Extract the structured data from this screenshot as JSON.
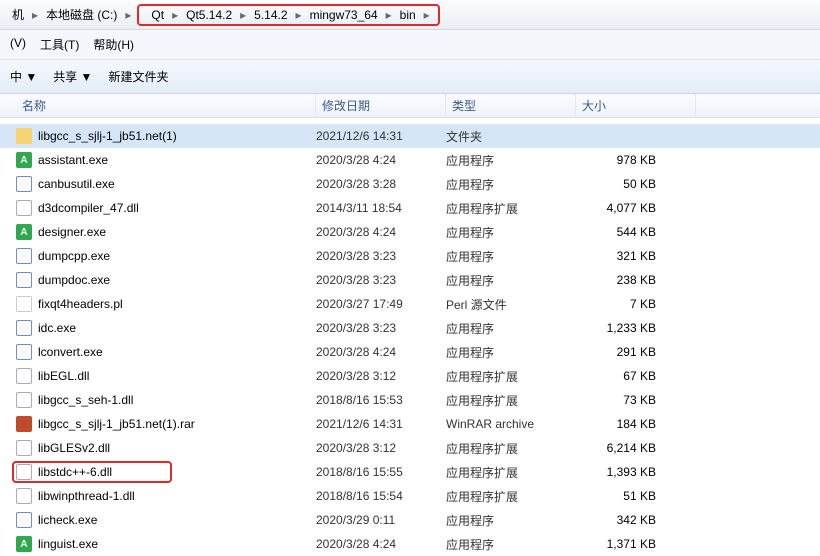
{
  "breadcrumb_pre": {
    "computer": "机",
    "sep1": "▸",
    "disk": "本地磁盘 (C:)",
    "sep2": "▸"
  },
  "breadcrumb": [
    {
      "label": "Qt"
    },
    {
      "label": "Qt5.14.2"
    },
    {
      "label": "5.14.2"
    },
    {
      "label": "mingw73_64"
    },
    {
      "label": "bin"
    }
  ],
  "menu": {
    "view": "(V)",
    "tools": "工具(T)",
    "help": "帮助(H)"
  },
  "toolbar": {
    "include": "中 ▼",
    "share": "共享 ▼",
    "newfolder": "新建文件夹"
  },
  "columns": {
    "name": "名称",
    "date": "修改日期",
    "type": "类型",
    "size": "大小"
  },
  "files": [
    {
      "icon": "folder",
      "name": "libgcc_s_sjlj-1_jb51.net(1)",
      "date": "2021/12/6 14:31",
      "type": "文件夹",
      "size": "",
      "selected": true
    },
    {
      "icon": "green",
      "name": "assistant.exe",
      "date": "2020/3/28 4:24",
      "type": "应用程序",
      "size": "978 KB"
    },
    {
      "icon": "exe",
      "name": "canbusutil.exe",
      "date": "2020/3/28 3:28",
      "type": "应用程序",
      "size": "50 KB"
    },
    {
      "icon": "dll",
      "name": "d3dcompiler_47.dll",
      "date": "2014/3/11 18:54",
      "type": "应用程序扩展",
      "size": "4,077 KB"
    },
    {
      "icon": "green",
      "name": "designer.exe",
      "date": "2020/3/28 4:24",
      "type": "应用程序",
      "size": "544 KB"
    },
    {
      "icon": "exe",
      "name": "dumpcpp.exe",
      "date": "2020/3/28 3:23",
      "type": "应用程序",
      "size": "321 KB"
    },
    {
      "icon": "exe",
      "name": "dumpdoc.exe",
      "date": "2020/3/28 3:23",
      "type": "应用程序",
      "size": "238 KB"
    },
    {
      "icon": "pl",
      "name": "fixqt4headers.pl",
      "date": "2020/3/27 17:49",
      "type": "Perl 源文件",
      "size": "7 KB"
    },
    {
      "icon": "exe",
      "name": "idc.exe",
      "date": "2020/3/28 3:23",
      "type": "应用程序",
      "size": "1,233 KB"
    },
    {
      "icon": "exe",
      "name": "lconvert.exe",
      "date": "2020/3/28 4:24",
      "type": "应用程序",
      "size": "291 KB"
    },
    {
      "icon": "dll",
      "name": "libEGL.dll",
      "date": "2020/3/28 3:12",
      "type": "应用程序扩展",
      "size": "67 KB"
    },
    {
      "icon": "dll",
      "name": "libgcc_s_seh-1.dll",
      "date": "2018/8/16 15:53",
      "type": "应用程序扩展",
      "size": "73 KB"
    },
    {
      "icon": "rar",
      "name": "libgcc_s_sjlj-1_jb51.net(1).rar",
      "date": "2021/12/6 14:31",
      "type": "WinRAR archive",
      "size": "184 KB"
    },
    {
      "icon": "dll",
      "name": "libGLESv2.dll",
      "date": "2020/3/28 3:12",
      "type": "应用程序扩展",
      "size": "6,214 KB"
    },
    {
      "icon": "dll",
      "name": "libstdc++-6.dll",
      "date": "2018/8/16 15:55",
      "type": "应用程序扩展",
      "size": "1,393 KB",
      "redbox": true
    },
    {
      "icon": "dll",
      "name": "libwinpthread-1.dll",
      "date": "2018/8/16 15:54",
      "type": "应用程序扩展",
      "size": "51 KB"
    },
    {
      "icon": "exe",
      "name": "licheck.exe",
      "date": "2020/3/29 0:11",
      "type": "应用程序",
      "size": "342 KB"
    },
    {
      "icon": "green",
      "name": "linguist.exe",
      "date": "2020/3/28 4:24",
      "type": "应用程序",
      "size": "1,371 KB"
    }
  ]
}
